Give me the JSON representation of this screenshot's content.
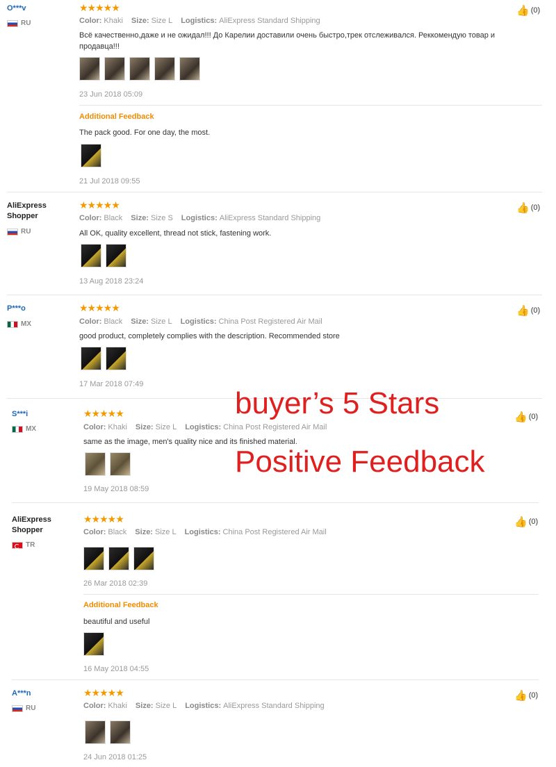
{
  "reviews": [
    {
      "user": "O***v",
      "country": "RU",
      "stars": "★★★★★",
      "color_label": "Color:",
      "color": "Khaki",
      "size_label": "Size:",
      "size": "Size L",
      "logistics_label": "Logistics:",
      "logistics": "AliExpress Standard Shipping",
      "text": "Всё качественно,даже и не ожидал!!! До Карелии доставили очень быстро,трек отслеживался. Реккомендую товар и продавца!!!",
      "date": "23 Jun 2018 05:09",
      "additional_label": "Additional Feedback",
      "additional_text": "The pack good. For one day, the most.",
      "additional_date": "21 Jul 2018 09:55",
      "likes": "(0)"
    },
    {
      "user": "AliExpress Shopper",
      "country": "RU",
      "stars": "★★★★★",
      "color_label": "Color:",
      "color": "Black",
      "size_label": "Size:",
      "size": "Size S",
      "logistics_label": "Logistics:",
      "logistics": "AliExpress Standard Shipping",
      "text": "All OK, quality excellent, thread not stick, fastening work.",
      "date": "13 Aug 2018 23:24",
      "likes": "(0)"
    },
    {
      "user": "P***o",
      "country": "MX",
      "stars": "★★★★★",
      "color_label": "Color:",
      "color": "Black",
      "size_label": "Size:",
      "size": "Size L",
      "logistics_label": "Logistics:",
      "logistics": "China Post Registered Air Mail",
      "text": "good product, completely complies with the description. Recommended store",
      "date": "17 Mar 2018 07:49",
      "likes": "(0)"
    },
    {
      "user": "S***i",
      "country": "MX",
      "stars": "★★★★★",
      "color_label": "Color:",
      "color": "Khaki",
      "size_label": "Size:",
      "size": "Size L",
      "logistics_label": "Logistics:",
      "logistics": "China Post Registered Air Mail",
      "text": "same as the image, men's quality nice and its finished material.",
      "date": "19 May 2018 08:59",
      "likes": "(0)"
    },
    {
      "user": "AliExpress Shopper",
      "country": "TR",
      "stars": "★★★★★",
      "color_label": "Color:",
      "color": "Black",
      "size_label": "Size:",
      "size": "Size L",
      "logistics_label": "Logistics:",
      "logistics": "China Post Registered Air Mail",
      "date": "26 Mar 2018 02:39",
      "additional_label": "Additional Feedback",
      "additional_text": "beautiful and useful",
      "additional_date": "16 May 2018 04:55",
      "likes": "(0)"
    },
    {
      "user": "A***n",
      "country": "RU",
      "stars": "★★★★★",
      "color_label": "Color:",
      "color": "Khaki",
      "size_label": "Size:",
      "size": "Size L",
      "logistics_label": "Logistics:",
      "logistics": "AliExpress Standard Shipping",
      "date": "24 Jun 2018 01:25",
      "likes": "(0)"
    }
  ],
  "overlay": {
    "line1": "buyer’s 5 Stars",
    "line2": "Positive Feedback"
  },
  "colors": {
    "accent": "#f29a00",
    "link": "#2167b4",
    "overlay": "#e01f1f"
  }
}
